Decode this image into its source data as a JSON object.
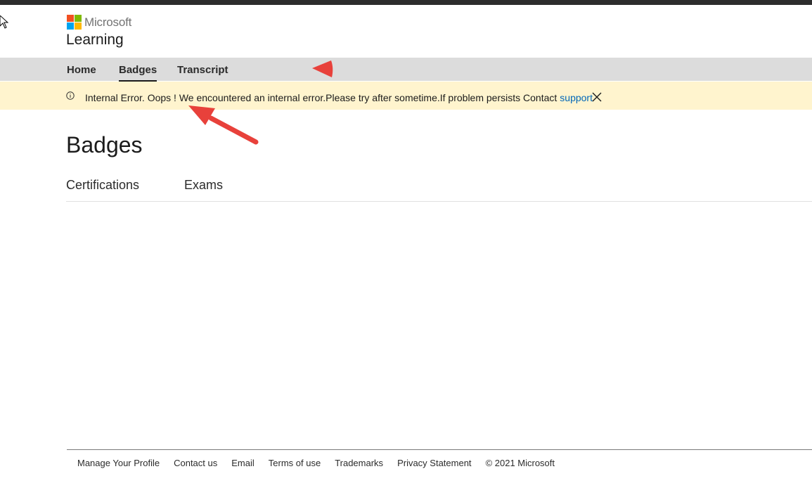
{
  "brand": {
    "company": "Microsoft",
    "site_title": "Learning",
    "logo_colors": [
      "#f25022",
      "#7fba00",
      "#00a4ef",
      "#ffb900"
    ]
  },
  "nav": {
    "tabs": [
      {
        "label": "Home"
      },
      {
        "label": "Badges",
        "active": true
      },
      {
        "label": "Transcript"
      }
    ]
  },
  "alert": {
    "icon": "info-icon",
    "message": "Internal Error. Oops ! We encountered an internal error.Please try after sometime.If problem persists Contact",
    "link_label": "support",
    "close_icon": "close-icon",
    "background": "#fff4ce",
    "link_color": "#0067b8"
  },
  "page": {
    "title": "Badges",
    "subtabs": [
      {
        "label": "Certifications"
      },
      {
        "label": "Exams"
      }
    ]
  },
  "footer": {
    "links": [
      "Manage Your Profile",
      "Contact us",
      "Email",
      "Terms of use",
      "Trademarks",
      "Privacy Statement"
    ],
    "copyright": "© 2021 Microsoft"
  },
  "annotations": {
    "arrow_color": "#e8413b"
  }
}
